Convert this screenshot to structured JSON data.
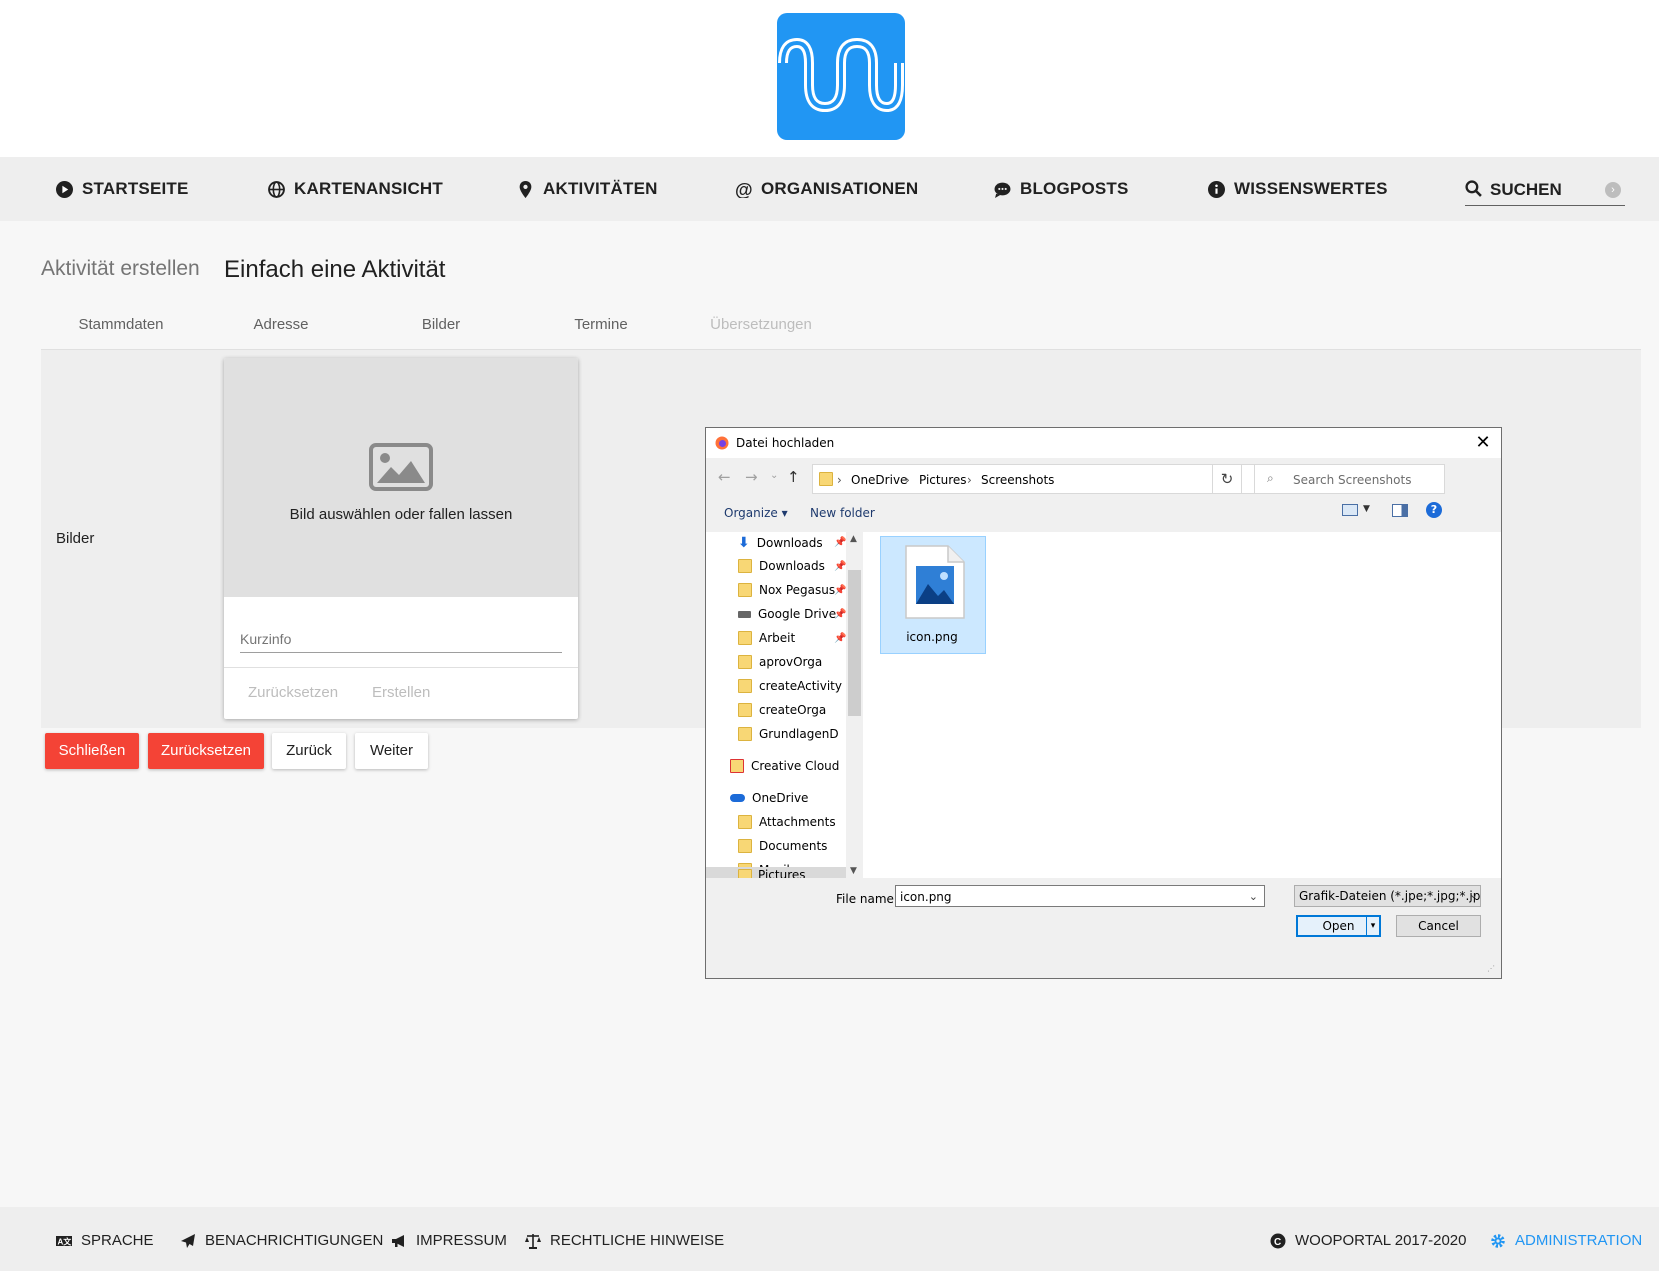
{
  "nav": {
    "startseite": "Startseite",
    "kartenansicht": "Kartenansicht",
    "aktivitaeten": "Aktivitäten",
    "organisationen": "Organisationen",
    "blogposts": "Blogposts",
    "wissenswertes": "Wissenswertes",
    "suchen": "Suchen"
  },
  "page": {
    "breadcrumb_label": "Aktivität erstellen",
    "title": "Einfach eine Aktivität"
  },
  "tabs": [
    "Stammdaten",
    "Adresse",
    "Bilder",
    "Termine",
    "Übersetzungen"
  ],
  "form": {
    "section_label": "Bilder",
    "drop_text": "Bild auswählen oder fallen lassen",
    "kurzinfo_placeholder": "Kurzinfo",
    "reset_label": "Zurücksetzen",
    "create_label": "Erstellen"
  },
  "actions": {
    "close": "Schließen",
    "reset": "Zurücksetzen",
    "back": "Zurück",
    "next": "Weiter"
  },
  "footer": {
    "sprache": "Sprache",
    "benachrichtigungen": "Benachrichtigungen",
    "impressum": "Impressum",
    "rechtliche_hinweise": "Rechtliche Hinweise",
    "copyright": "WOOPORTAL 2017-2020",
    "administration": "Administration"
  },
  "colors": {
    "brand": "#2196f3",
    "danger": "#f44336",
    "nav_bg": "#eeeeee"
  },
  "dialog": {
    "title": "Datei hochladen",
    "path": [
      "OneDrive",
      "Pictures",
      "Screenshots"
    ],
    "search_placeholder": "Search Screenshots",
    "organize": "Organize",
    "new_folder": "New folder",
    "tree": [
      "Downloads",
      "Downloads",
      "Nox Pegasus",
      "Google Drive",
      "Arbeit",
      "aprovOrga",
      "createActivity",
      "createOrga",
      "GrundlagenDerV",
      "Creative Cloud Fil",
      "OneDrive",
      "Attachments",
      "Documents",
      "Musik",
      "Pictures"
    ],
    "file_name": "icon.png",
    "file_name_label": "File name:",
    "file_type": "Grafik-Dateien (*.jpe;*.jpg;*.jpeg",
    "open": "Open",
    "cancel": "Cancel"
  }
}
